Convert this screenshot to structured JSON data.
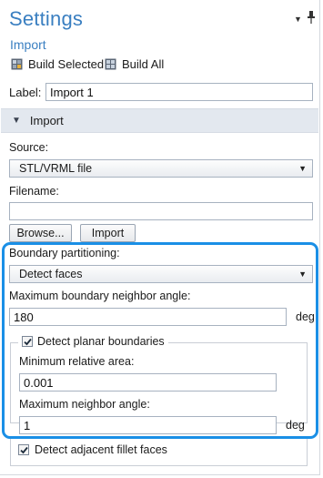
{
  "header": {
    "title": "Settings",
    "subtitle": "Import",
    "build_selected_label": "Build Selected",
    "build_all_label": "Build All"
  },
  "label_field": {
    "label": "Label:",
    "value": "Import 1"
  },
  "import_section": {
    "title": "Import",
    "source": {
      "label": "Source:",
      "value": "STL/VRML file"
    },
    "filename": {
      "label": "Filename:",
      "value": ""
    },
    "browse_label": "Browse...",
    "import_label": "Import",
    "boundary_partitioning": {
      "label": "Boundary partitioning:",
      "value": "Detect faces"
    },
    "max_boundary_neighbor_angle": {
      "label": "Maximum boundary neighbor angle:",
      "value": "180",
      "unit": "deg"
    },
    "detect_planar_boundaries": {
      "label": "Detect planar boundaries",
      "checked": true,
      "min_relative_area": {
        "label": "Minimum relative area:",
        "value": "0.001"
      },
      "max_neighbor_angle": {
        "label": "Maximum neighbor angle:",
        "value": "1",
        "unit": "deg"
      }
    },
    "detect_fillet": {
      "label": "Detect adjacent fillet faces",
      "checked": true
    }
  },
  "colors": {
    "title": "#3a7fc1",
    "highlight": "#1a8fe6",
    "section_bg": "#e3e8ef"
  },
  "icons": [
    "pin-icon",
    "build-selected-icon",
    "build-all-icon",
    "collapse-triangle-icon",
    "dropdown-chevron-icon",
    "checkmark-icon"
  ]
}
